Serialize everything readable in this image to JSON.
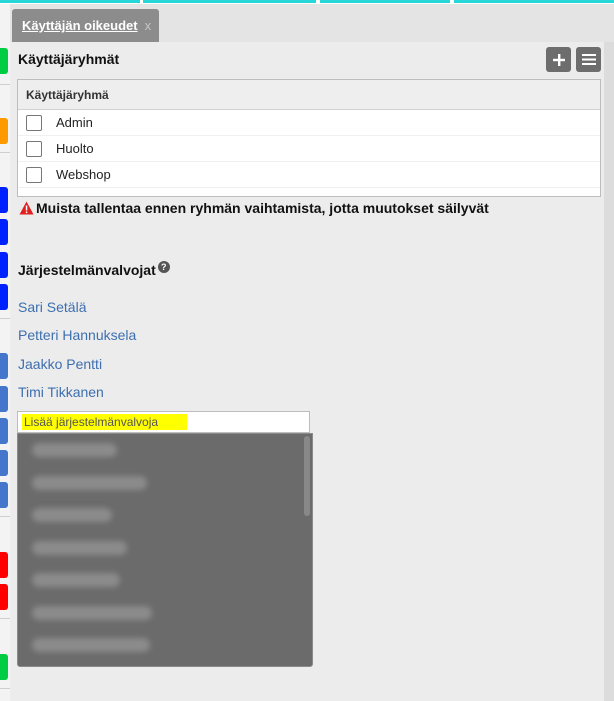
{
  "tab": {
    "label": "Käyttäjän oikeudet",
    "close": "x"
  },
  "groups": {
    "title": "Käyttäjäryhmät",
    "add_icon": "plus-icon",
    "menu_icon": "menu-icon",
    "column_header": "Käyttäjäryhmä",
    "rows": [
      {
        "label": "Admin",
        "checked": false
      },
      {
        "label": "Huolto",
        "checked": false
      },
      {
        "label": "Webshop",
        "checked": false
      }
    ]
  },
  "warning": {
    "icon": "warning-icon",
    "text": "Muista tallentaa ennen ryhmän vaihtamista, jotta muutokset säilyvät"
  },
  "admins": {
    "title": "Järjestelmänvalvojat",
    "help_icon": "help-icon",
    "list": [
      "Sari Setälä",
      "Petteri Hannuksela",
      "Jaakko Pentti",
      "Timi Tikkanen"
    ],
    "add_placeholder": "Lisää järjestelmänvalvoja"
  },
  "colors": {
    "accent_cyan": "#27d7d7",
    "tab_bg": "#8c8c8c",
    "link": "#3d6fb0",
    "highlight": "#ffff00",
    "left_marks": [
      "#00cc44",
      "#ff9900",
      "#0022ff",
      "#0022ff",
      "#0022ff",
      "#0022ff",
      "#4477cc",
      "#4477cc",
      "#4477cc",
      "#4477cc",
      "#4477cc",
      "#ff0000",
      "#ff0000",
      "#00cc44"
    ]
  }
}
